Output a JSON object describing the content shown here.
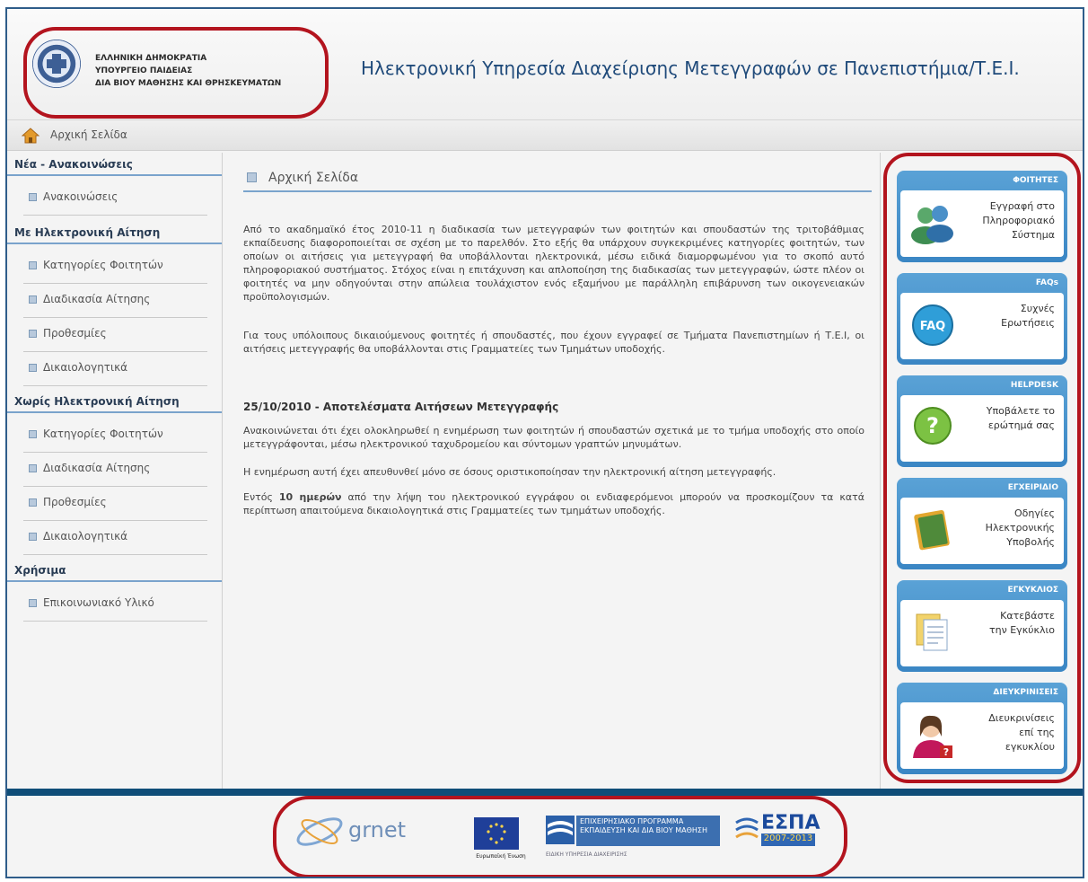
{
  "header": {
    "ministry_lines": [
      "ΕΛΛΗΝΙΚΗ ΔΗΜΟΚΡΑΤΙΑ",
      "ΥΠΟΥΡΓΕΙΟ ΠΑΙΔΕΙΑΣ",
      "ΔΙΑ ΒΙΟΥ ΜΑΘΗΣΗΣ ΚΑΙ ΘΡΗΣΚΕΥΜΑΤΩΝ"
    ],
    "site_title": "Ηλεκτρονική Υπηρεσία Διαχείρισης Μετεγγραφών σε Πανεπιστήμια/Τ.Ε.Ι."
  },
  "breadcrumb": {
    "home_label": "Αρχική Σελίδα"
  },
  "sidebar": {
    "sections": [
      {
        "title": "Νέα - Ανακοινώσεις",
        "items": [
          "Ανακοινώσεις"
        ]
      },
      {
        "title": "Με Ηλεκτρονική Αίτηση",
        "items": [
          "Κατηγορίες Φοιτητών",
          "Διαδικασία Αίτησης",
          "Προθεσμίες",
          "Δικαιολογητικά"
        ]
      },
      {
        "title": "Χωρίς Ηλεκτρονική Αίτηση",
        "items": [
          "Κατηγορίες Φοιτητών",
          "Διαδικασία Αίτησης",
          "Προθεσμίες",
          "Δικαιολογητικά"
        ]
      },
      {
        "title": "Χρήσιμα",
        "items": [
          "Επικοινωνιακό Υλικό"
        ]
      }
    ]
  },
  "main": {
    "heading": "Αρχική Σελίδα",
    "intro_p1": "Από το ακαδημαϊκό έτος 2010-11 η διαδικασία των μετεγγραφών των φοιτητών και σπουδαστών της τριτοβάθμιας εκπαίδευσης διαφοροποιείται σε σχέση με το παρελθόν. Στο εξής θα υπάρχουν συγκεκριμένες κατηγορίες φοιτητών, των οποίων οι αιτήσεις για μετεγγραφή θα υποβάλλονται ηλεκτρονικά, μέσω ειδικά διαμορφωμένου για το σκοπό αυτό πληροφοριακού συστήματος. Στόχος είναι η επιτάχυνση και απλοποίηση της διαδικασίας των μετεγγραφών, ώστε πλέον οι φοιτητές να μην οδηγούνται στην απώλεια τουλάχιστον ενός εξαμήνου με παράλληλη επιβάρυνση των οικογενειακών προϋπολογισμών.",
    "intro_p2": "Για τους υπόλοιπους δικαιούμενους φοιτητές ή σπουδαστές, που έχουν εγγραφεί σε Τμήματα Πανεπιστημίων ή Τ.Ε.Ι, οι αιτήσεις μετεγγραφής θα υποβάλλονται στις Γραμματείες των Τμημάτων υποδοχής.",
    "news_title": "25/10/2010 - Αποτελέσματα Αιτήσεων Μετεγγραφής",
    "news_p1": "Ανακοινώνεται ότι έχει ολοκληρωθεί η ενημέρωση των φοιτητών ή σπουδαστών σχετικά με το τμήμα υποδοχής στο οποίο μετεγγράφονται, μέσω ηλεκτρονικού ταχυδρομείου και σύντομων γραπτών μηνυμάτων.",
    "news_p2": "Η ενημέρωση αυτή έχει απευθυνθεί μόνο σε όσους οριστικοποίησαν την ηλεκτρονική αίτηση μετεγγραφής.",
    "news_p3_prefix": "Εντός",
    "news_p3_bold": "10 ημερών",
    "news_p3_rest": "από την λήψη του ηλεκτρονικού εγγράφου οι ενδιαφερόμενοι μπορούν να προσκομίζουν τα κατά περίπτωση απαιτούμενα δικαιολογητικά στις Γραμματείες των τμημάτων υποδοχής."
  },
  "widgets": [
    {
      "title": "ΦΟΙΤΗΤΕΣ",
      "lines": [
        "Εγγραφή στο",
        "Πληροφοριακό",
        "Σύστημα"
      ],
      "icon": "users-icon"
    },
    {
      "title": "FAQs",
      "lines": [
        "Συχνές",
        "Ερωτήσεις"
      ],
      "icon": "faq-icon"
    },
    {
      "title": "HELPDESK",
      "lines": [
        "Υποβάλετε το",
        "ερώτημά σας"
      ],
      "icon": "question-icon"
    },
    {
      "title": "ΕΓΧΕΙΡΙΔΙΟ",
      "lines": [
        "Οδηγίες",
        "Ηλεκτρονικής",
        "Υποβολής"
      ],
      "icon": "book-icon"
    },
    {
      "title": "ΕΓΚΥΚΛΙΟΣ",
      "lines": [
        "Κατεβάστε",
        "την Εγκύκλιο"
      ],
      "icon": "document-icon"
    },
    {
      "title": "ΔΙΕΥΚΡΙΝΙΣΕΙΣ",
      "lines": [
        "Διευκρινίσεις",
        "επί της",
        "εγκυκλίου"
      ],
      "icon": "person-help-icon"
    }
  ],
  "footer": {
    "grnet": "grnet",
    "eu_caption": "Ευρωπαϊκή Ένωση",
    "ep_banner": [
      "ΕΠΙΧΕΙΡΗΣΙΑΚΟ ΠΡΟΓΡΑΜΜΑ",
      "ΕΚΠΑΙΔΕΥΣΗ ΚΑΙ ΔΙΑ ΒΙΟΥ ΜΑΘΗΣΗ"
    ],
    "ep_small": "ΕΙΔΙΚΗ ΥΠΗΡΕΣΙΑ ΔΙΑΧΕΙΡΙΣΗΣ",
    "espa": "ΕΣΠΑ",
    "espa_years": "2007-2013"
  }
}
